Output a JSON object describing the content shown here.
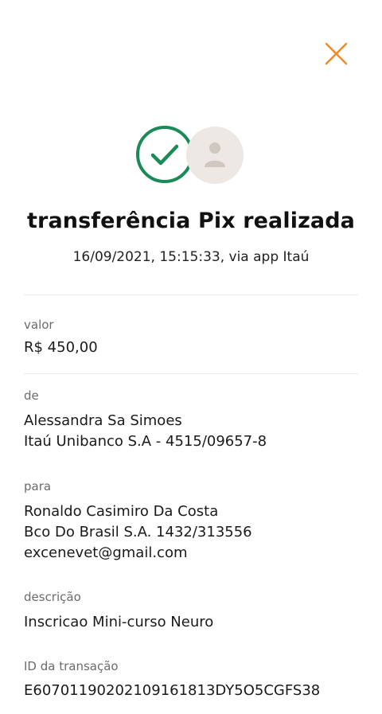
{
  "header": {
    "close_icon": "close-icon",
    "accent_color": "#f08c28"
  },
  "status": {
    "success_icon": "check-circle-icon",
    "success_color": "#1a8a57",
    "avatar_icon": "person-icon",
    "title": "transferência Pix realizada",
    "subtitle": "16/09/2021, 15:15:33, via app Itaú"
  },
  "details": {
    "valor": {
      "label": "valor",
      "amount": "R$ 450,00"
    },
    "de": {
      "label": "de",
      "name": "Alessandra Sa Simoes",
      "bank": "Itaú Unibanco S.A - 4515/09657-8"
    },
    "para": {
      "label": "para",
      "name": "Ronaldo Casimiro Da Costa",
      "bank": "Bco Do Brasil S.A. 1432/313556",
      "key": "excenevet@gmail.com"
    },
    "descricao": {
      "label": "descrição",
      "text": "Inscricao Mini-curso Neuro"
    },
    "id_transacao": {
      "label": "ID da transação",
      "id": "E60701190202109161813DY5O5CGFS38"
    }
  }
}
